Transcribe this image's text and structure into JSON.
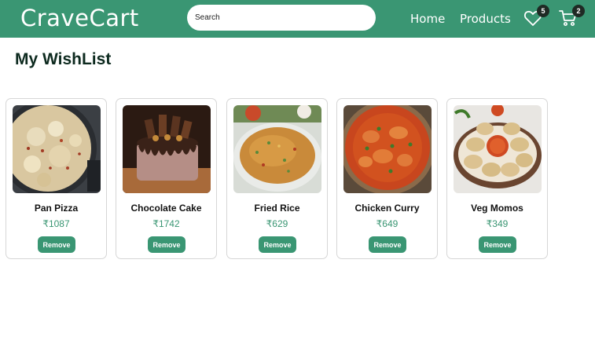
{
  "header": {
    "logo": "CraveCart",
    "search_placeholder": "Search",
    "nav": {
      "home": "Home",
      "products": "Products"
    },
    "wishlist_count": "5",
    "cart_count": "2",
    "colors": {
      "brand": "#3a9673",
      "badge": "#1f2a24"
    }
  },
  "page": {
    "title": "My WishList"
  },
  "wishlist": {
    "remove_label": "Remove",
    "items": [
      {
        "name": "Pan Pizza",
        "price": "₹1087",
        "image": "pan-pizza-photo"
      },
      {
        "name": "Chocolate Cake",
        "price": "₹1742",
        "image": "chocolate-cake-photo"
      },
      {
        "name": "Fried Rice",
        "price": "₹629",
        "image": "fried-rice-photo"
      },
      {
        "name": "Chicken Curry",
        "price": "₹649",
        "image": "chicken-curry-photo"
      },
      {
        "name": "Veg Momos",
        "price": "₹349",
        "image": "veg-momos-photo"
      }
    ]
  }
}
